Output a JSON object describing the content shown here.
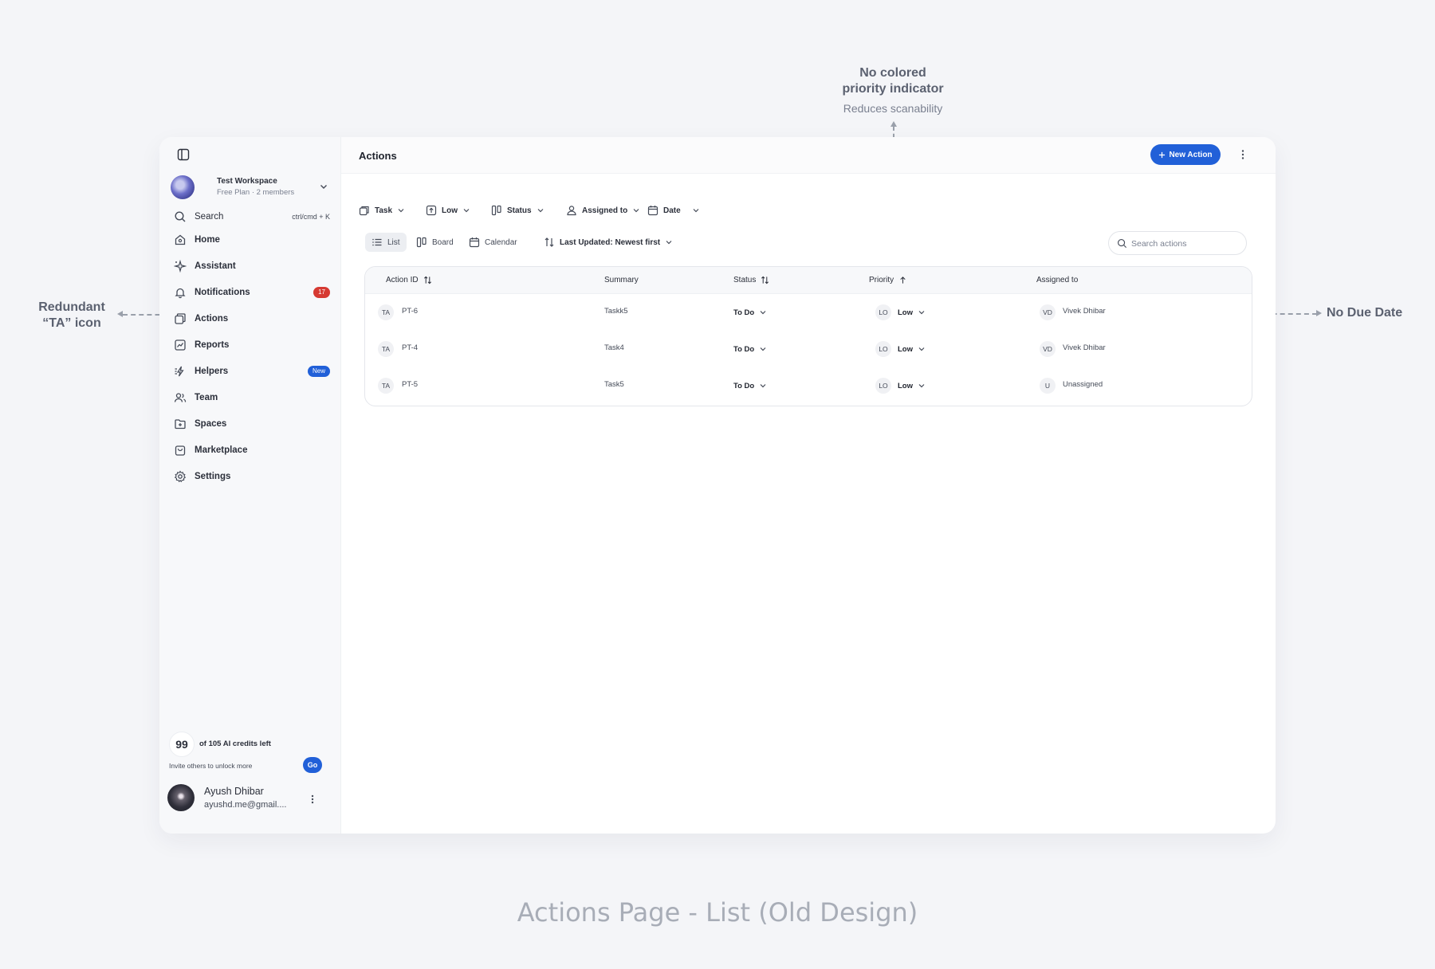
{
  "annotations": {
    "priority": {
      "title_line1": "No colored",
      "title_line2": "priority indicator",
      "sub": "Reduces scanability"
    },
    "redundant": {
      "line1": "Redundant",
      "line2": "“TA” icon"
    },
    "due": {
      "text": "No Due Date"
    }
  },
  "caption": "Actions Page - List (Old Design)",
  "sidebar": {
    "workspace": {
      "name": "Test Workspace",
      "plan": "Free Plan · 2 members"
    },
    "search": {
      "label": "Search",
      "shortcut": "ctrl/cmd + K"
    },
    "items": [
      {
        "label": "Home",
        "icon": "home-icon"
      },
      {
        "label": "Assistant",
        "icon": "sparkle-icon"
      },
      {
        "label": "Notifications",
        "icon": "bell-icon",
        "badge": "17"
      },
      {
        "label": "Actions",
        "icon": "actions-icon"
      },
      {
        "label": "Reports",
        "icon": "chart-icon"
      },
      {
        "label": "Helpers",
        "icon": "bolt-icon",
        "badge": "New"
      },
      {
        "label": "Team",
        "icon": "team-icon"
      },
      {
        "label": "Spaces",
        "icon": "folder-icon"
      },
      {
        "label": "Marketplace",
        "icon": "bag-icon"
      },
      {
        "label": "Settings",
        "icon": "gear-icon"
      }
    ],
    "credits": {
      "count": "99",
      "text": "of 105 AI credits left",
      "invite": "Invite others to unlock more",
      "go": "Go"
    },
    "user": {
      "name": "Ayush Dhibar",
      "email": "ayushd.me@gmail...."
    }
  },
  "header": {
    "title": "Actions",
    "new_button": "New Action"
  },
  "filters": [
    {
      "label": "Task",
      "icon": "task-icon"
    },
    {
      "label": "Low",
      "icon": "priority-icon"
    },
    {
      "label": "Status",
      "icon": "columns-icon"
    },
    {
      "label": "Assigned to",
      "icon": "user-icon"
    },
    {
      "label": "Date",
      "icon": "calendar-icon"
    }
  ],
  "views": [
    {
      "label": "List",
      "icon": "list-icon",
      "active": true
    },
    {
      "label": "Board",
      "icon": "board-icon"
    },
    {
      "label": "Calendar",
      "icon": "calendar-icon"
    }
  ],
  "sort": {
    "label": "Last Updated: Newest first"
  },
  "search": {
    "placeholder": "Search actions"
  },
  "table": {
    "columns": [
      "Action ID",
      "Summary",
      "Status",
      "Priority",
      "Assigned to"
    ],
    "rows": [
      {
        "type_chip": "TA",
        "id": "PT-6",
        "summary": "Taskk5",
        "status": "To Do",
        "priority_chip": "LO",
        "priority": "Low",
        "assignee_chip": "VD",
        "assignee": "Vivek Dhibar"
      },
      {
        "type_chip": "TA",
        "id": "PT-4",
        "summary": "Task4",
        "status": "To Do",
        "priority_chip": "LO",
        "priority": "Low",
        "assignee_chip": "VD",
        "assignee": "Vivek Dhibar"
      },
      {
        "type_chip": "TA",
        "id": "PT-5",
        "summary": "Task5",
        "status": "To Do",
        "priority_chip": "LO",
        "priority": "Low",
        "assignee_chip": "U",
        "assignee": "Unassigned"
      }
    ]
  },
  "colors": {
    "accent": "#2160d8",
    "badge_red": "#d63a32",
    "background": "#f4f5f8"
  }
}
